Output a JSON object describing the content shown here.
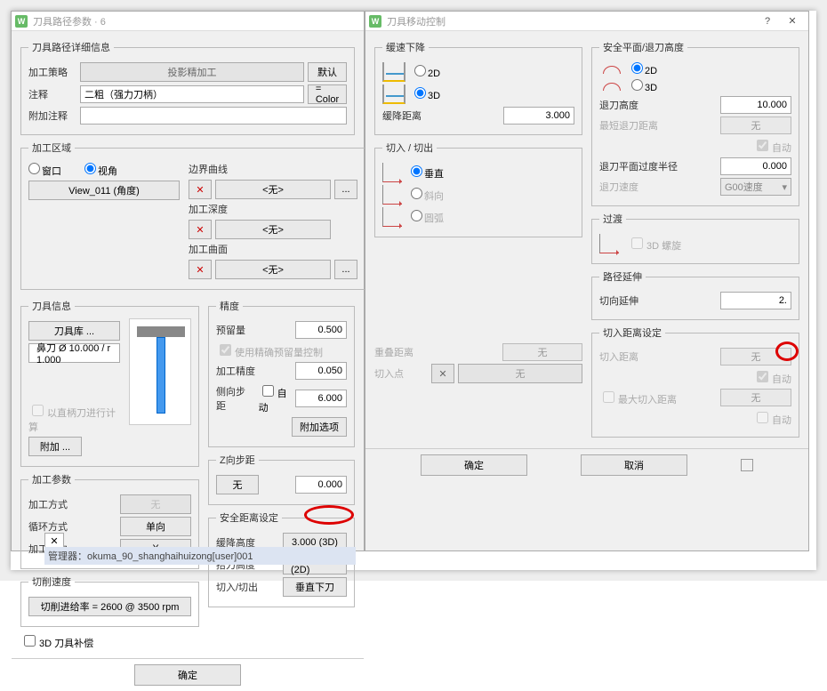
{
  "left": {
    "title": "刀具路径参数 · 6",
    "details_legend": "刀具路径详细信息",
    "strategy_lbl": "加工策略",
    "strategy_val": "投影精加工",
    "default_btn": "默认",
    "comment_lbl": "注释",
    "comment_val": "二粗（强力刀柄）",
    "color_btn": "= Color",
    "extra_comment_lbl": "附加注释",
    "extra_comment_val": "",
    "area_legend": "加工区域",
    "window_rb": "窗口",
    "view_rb": "视角",
    "view_btn": "View_011 (角度)",
    "boundary_lbl": "边界曲线",
    "none_btn": "<无>",
    "dots_btn": "...",
    "depth_lbl": "加工深度",
    "surface_lbl": "加工曲面",
    "tool_legend": "刀具信息",
    "toollib_btn": "刀具库 ...",
    "tool_spec": "鼻刀 Ø 10.000 / r 1.000",
    "calc_chk": "以直柄刀进行计算",
    "attach_btn": "附加 ...",
    "params_legend": "加工参数",
    "method_lbl": "加工方式",
    "method_val": "无",
    "cycle_lbl": "循环方式",
    "cycle_val": "单向",
    "dir_lbl": "加工方向",
    "dir_val": "X",
    "speed_legend": "切削速度",
    "feed_btn": "切削进给率 = 2600 @ 3500 rpm",
    "comp_chk": "3D 刀具补偿",
    "prec_legend": "精度",
    "stock_lbl": "预留量",
    "stock_val": "0.500",
    "use_prec_chk": "使用精确预留量控制",
    "prec_lbl": "加工精度",
    "prec_val": "0.050",
    "step_lbl": "侧向步距",
    "auto_chk": "自动",
    "step_val": "6.000",
    "addopt_btn": "附加选项",
    "zstep_legend": "Z向步距",
    "zstep_btn": "无",
    "zstep_val": "0.000",
    "safe_legend": "安全距离设定",
    "ramp_lbl": "缓降高度",
    "ramp_val": "3.000 (3D)",
    "lift_lbl": "抬刀高度",
    "lift_val": "10.000 (2D)",
    "cut_lbl": "切入/切出",
    "cut_btn": "垂直下刀",
    "ok_btn": "确定"
  },
  "right": {
    "title": "刀具移动控制",
    "ramp_legend": "缓速下降",
    "rb_2d": "2D",
    "rb_3d": "3D",
    "rampdist_lbl": "缓降距离",
    "rampdist_val": "3.000",
    "safe_legend": "安全平面/退刀高度",
    "retract_lbl": "退刀高度",
    "retract_val": "10.000",
    "minretract_lbl": "最短退刀距离",
    "minretract_val": "无",
    "auto_chk": "自动",
    "clear_lbl": "退刀平面过度半径",
    "clear_val": "0.000",
    "retractspd_lbl": "退刀速度",
    "retractspd_val": "G00速度",
    "cut_legend": "切入 / 切出",
    "vert_rb": "垂直",
    "angle_rb": "斜向",
    "arc_rb": "圆弧",
    "trans_legend": "过渡",
    "helix_chk": "3D 螺旋",
    "ext_legend": "路径延伸",
    "tan_lbl": "切向延伸",
    "tan_val": "2.",
    "plunge_legend": "切入距离设定",
    "plunge_lbl": "切入距离",
    "plunge_val": "无",
    "auto2_chk": "自动",
    "maxplunge_chk": "最大切入距离",
    "maxplunge_val": "无",
    "auto3_chk": "自动",
    "overlap_lbl": "重叠距离",
    "overlap_val": "无",
    "cutpt_lbl": "切入点",
    "cutpt_val": "无",
    "ok_btn": "确定",
    "cancel_btn": "取消"
  },
  "status": "管理器：okuma_90_shanghaihuizong[user]001"
}
